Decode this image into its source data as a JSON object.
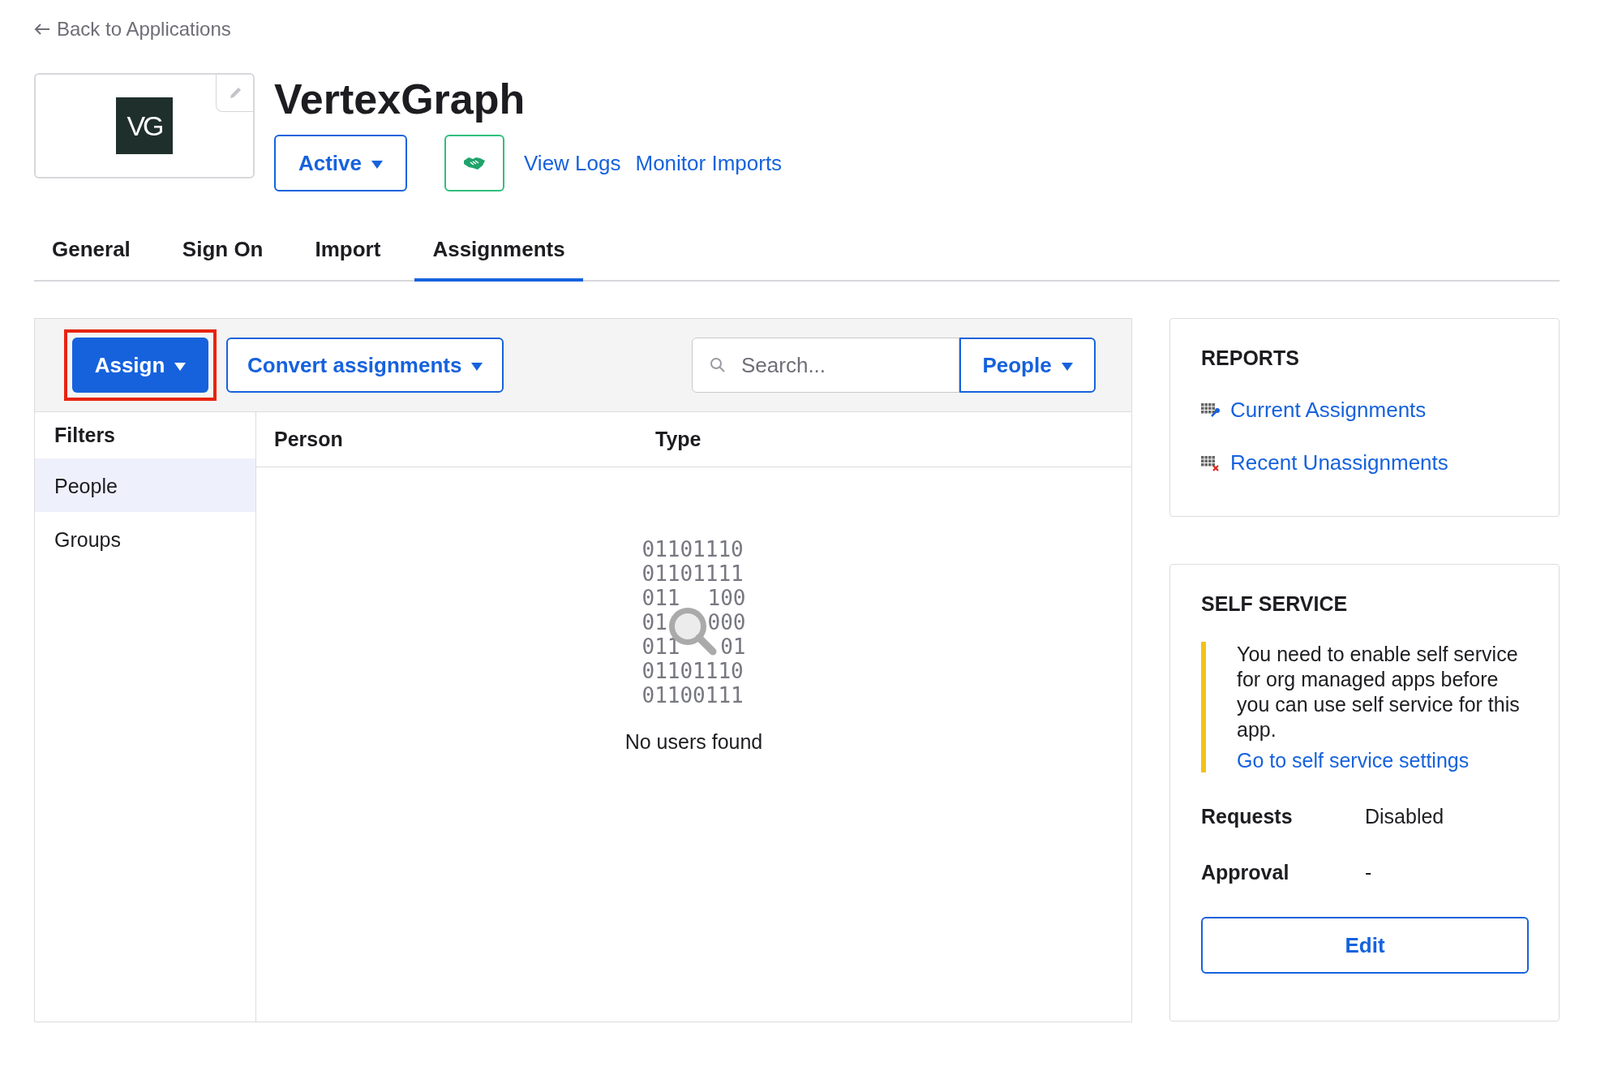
{
  "back_link": "Back to Applications",
  "app": {
    "logo_text": "VG",
    "title": "VertexGraph",
    "status": "Active",
    "links": [
      "View Logs",
      "Monitor Imports"
    ]
  },
  "tabs": [
    {
      "label": "General",
      "selected": false
    },
    {
      "label": "Sign On",
      "selected": false
    },
    {
      "label": "Import",
      "selected": false
    },
    {
      "label": "Assignments",
      "selected": true
    }
  ],
  "toolbar": {
    "assign": {
      "label": "Assign",
      "highlighted": true
    },
    "convert": "Convert assignments",
    "search": {
      "placeholder": "Search..."
    },
    "scope": "People"
  },
  "filters": {
    "title": "Filters",
    "items": [
      {
        "label": "People",
        "selected": true
      },
      {
        "label": "Groups",
        "selected": false
      }
    ]
  },
  "table": {
    "columns": [
      "Person",
      "Type"
    ],
    "empty_art": [
      [
        "01101110"
      ],
      [
        "01101111"
      ],
      [
        "011",
        "100"
      ],
      [
        "01",
        "000"
      ],
      [
        "011",
        "01"
      ],
      [
        "01101110"
      ],
      [
        "01100111"
      ]
    ],
    "empty_message": "No users found"
  },
  "reports": {
    "title": "REPORTS",
    "links": [
      {
        "label": "Current Assignments",
        "kind": "current"
      },
      {
        "label": "Recent Unassignments",
        "kind": "recent"
      }
    ]
  },
  "self_service": {
    "title": "SELF SERVICE",
    "notice": "You need to enable self service for org managed apps before you can use self service for this app.",
    "notice_link": "Go to self service settings",
    "fields": [
      {
        "label": "Requests",
        "value": "Disabled"
      },
      {
        "label": "Approval",
        "value": "-"
      }
    ],
    "edit": "Edit"
  }
}
